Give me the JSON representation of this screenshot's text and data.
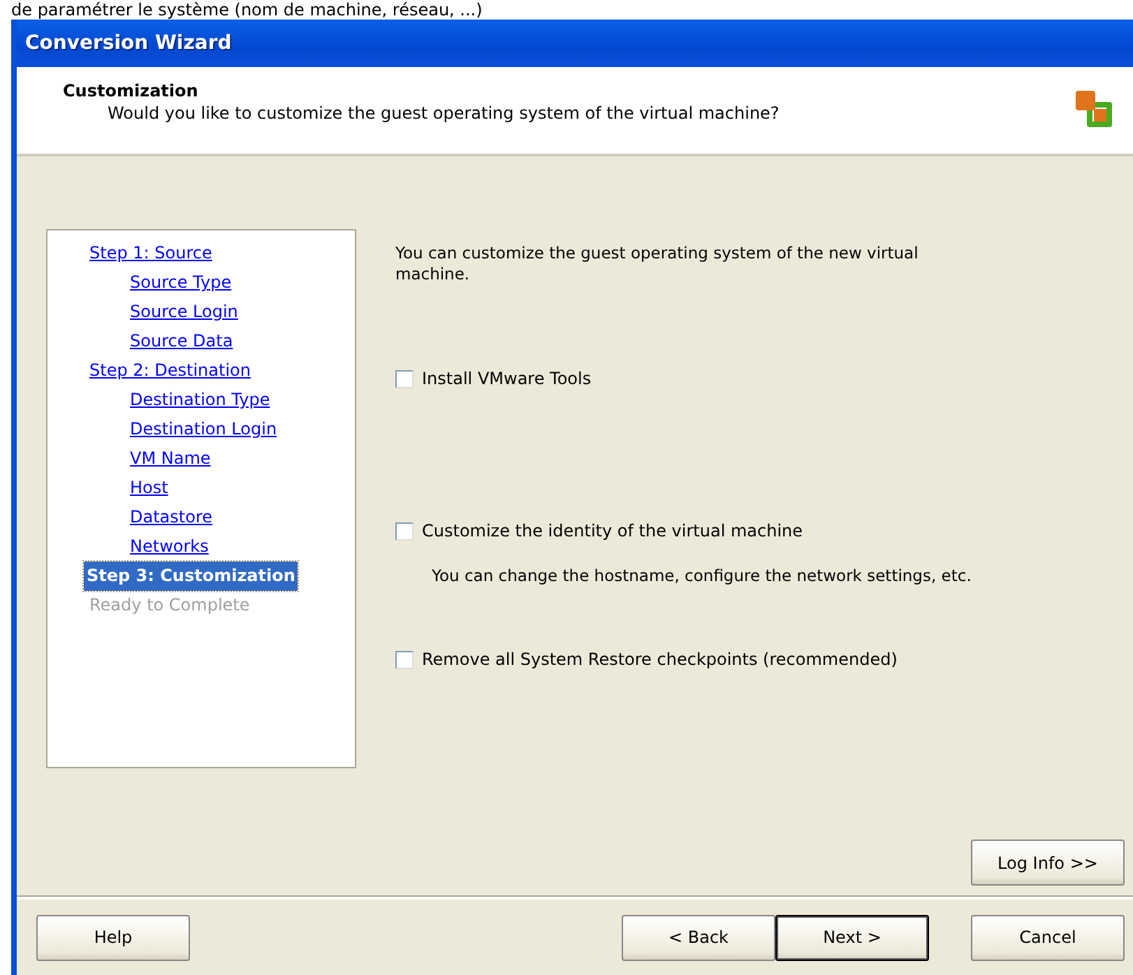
{
  "caption": "de paramétrer le système (nom de machine, réseau, ...)",
  "window": {
    "title": "Conversion Wizard"
  },
  "header": {
    "title": "Customization",
    "subtitle": "Would you like to customize the guest operating system of the virtual machine?"
  },
  "steps": [
    {
      "label": "Step 1: Source",
      "selected": false,
      "disabled": false,
      "children": [
        {
          "label": "Source Type",
          "selected": false,
          "disabled": false
        },
        {
          "label": "Source Login",
          "selected": false,
          "disabled": false
        },
        {
          "label": "Source Data",
          "selected": false,
          "disabled": false
        }
      ]
    },
    {
      "label": "Step 2: Destination",
      "selected": false,
      "disabled": false,
      "children": [
        {
          "label": "Destination Type",
          "selected": false,
          "disabled": false
        },
        {
          "label": "Destination Login",
          "selected": false,
          "disabled": false
        },
        {
          "label": "VM Name",
          "selected": false,
          "disabled": false
        },
        {
          "label": "Host",
          "selected": false,
          "disabled": false
        },
        {
          "label": "Datastore",
          "selected": false,
          "disabled": false
        },
        {
          "label": "Networks",
          "selected": false,
          "disabled": false
        }
      ]
    },
    {
      "label": "Step 3: Customization",
      "selected": true,
      "disabled": false
    },
    {
      "label": "Ready to Complete",
      "selected": false,
      "disabled": true
    }
  ],
  "intro": "You can customize the guest operating system of the new virtual machine.",
  "options": [
    {
      "label": "Install VMware Tools",
      "checked": false
    },
    {
      "label": "Customize the identity of the virtual machine",
      "checked": false,
      "description": "You can change the hostname, configure the network settings, etc."
    },
    {
      "label": "Remove all System Restore checkpoints (recommended)",
      "checked": false
    }
  ],
  "log_button": "Log Info >>",
  "footer_buttons": [
    {
      "label": "Help",
      "default": false
    },
    {
      "label": "< Back",
      "default": false
    },
    {
      "label": "Next >",
      "default": true
    },
    {
      "label": "Cancel",
      "default": false
    }
  ]
}
